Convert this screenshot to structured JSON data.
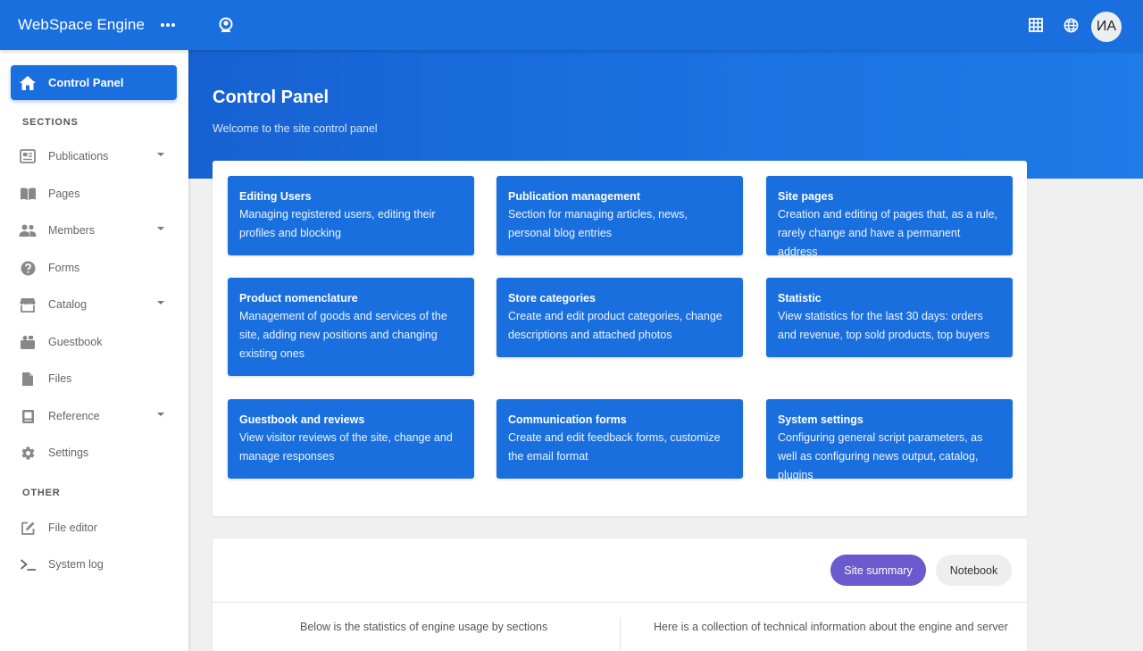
{
  "header": {
    "brand": "WebSpace Engine",
    "menu_icon": "more-horizontal-icon",
    "user_initials": "ИА"
  },
  "sidebar": {
    "active": {
      "label": "Control Panel",
      "icon": "home-icon"
    },
    "sections_heading": "SECTIONS",
    "items": [
      {
        "label": "Publications",
        "icon": "newspaper-icon",
        "has_submenu": true
      },
      {
        "label": "Pages",
        "icon": "book-icon",
        "has_submenu": false
      },
      {
        "label": "Members",
        "icon": "people-icon",
        "has_submenu": true
      },
      {
        "label": "Forms",
        "icon": "help-circle-icon",
        "has_submenu": false
      },
      {
        "label": "Catalog",
        "icon": "store-icon",
        "has_submenu": true
      },
      {
        "label": "Guestbook",
        "icon": "guestbook-icon",
        "has_submenu": false
      },
      {
        "label": "Files",
        "icon": "file-icon",
        "has_submenu": false
      },
      {
        "label": "Reference",
        "icon": "reference-book-icon",
        "has_submenu": true
      },
      {
        "label": "Settings",
        "icon": "gear-icon",
        "has_submenu": false
      }
    ],
    "other_heading": "OTHER",
    "other_items": [
      {
        "label": "File editor",
        "icon": "edit-icon"
      },
      {
        "label": "System log",
        "icon": "terminal-icon"
      }
    ]
  },
  "main": {
    "title": "Control Panel",
    "subtitle": "Welcome to the site control panel",
    "tiles": [
      {
        "title": "Editing Users",
        "desc": "Managing registered users, editing their profiles and blocking"
      },
      {
        "title": "Publication management",
        "desc": "Section for managing articles, news, personal blog entries"
      },
      {
        "title": "Site pages",
        "desc": "Creation and editing of pages that, as a rule, rarely change and have a permanent address"
      },
      {
        "title": "Product nomenclature",
        "desc": "Management of goods and services of the site, adding new positions and changing existing ones"
      },
      {
        "title": "Store categories",
        "desc": "Create and edit product categories, change descriptions and attached photos"
      },
      {
        "title": "Statistic",
        "desc": "View statistics for the last 30 days: orders and revenue, top sold products, top buyers"
      },
      {
        "title": "Guestbook and reviews",
        "desc": "View visitor reviews of the site, change and manage responses"
      },
      {
        "title": "Communication forms",
        "desc": "Create and edit feedback forms, customize the email format"
      },
      {
        "title": "System settings",
        "desc": "Configuring general script parameters, as well as configuring news output, catalog, plugins"
      }
    ],
    "tabs": [
      {
        "label": "Site summary",
        "active": true
      },
      {
        "label": "Notebook",
        "active": false
      }
    ],
    "summary_left": "Below is the statistics of engine usage by sections",
    "summary_right": "Here is a collection of technical information about the engine and server"
  },
  "colors": {
    "primary": "#1a6fdf",
    "tab_active": "#6a5acd",
    "background": "#f0f0f0"
  }
}
